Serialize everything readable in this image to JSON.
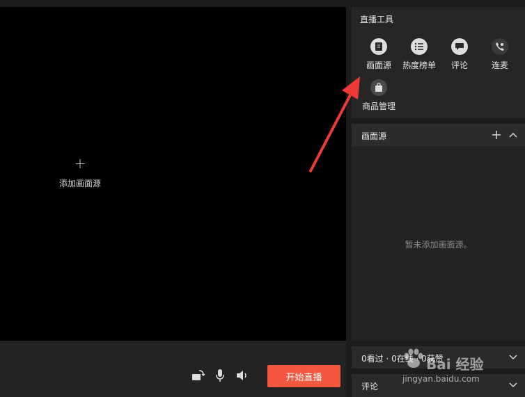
{
  "preview": {
    "add_source_label": "添加画面源"
  },
  "tools": {
    "title": "直播工具",
    "items": [
      {
        "label": "画面源",
        "icon": "document-icon"
      },
      {
        "label": "热度榜单",
        "icon": "list-icon"
      },
      {
        "label": "评论",
        "icon": "chat-bubble-icon"
      },
      {
        "label": "连麦",
        "icon": "phone-call-icon"
      },
      {
        "label": "商品管理",
        "icon": "shopping-bag-icon"
      }
    ]
  },
  "source_panel": {
    "title": "画面源",
    "empty_message": "暂未添加画面源。"
  },
  "stats": {
    "text": "0看过 · 0在线 · 0获赞"
  },
  "comment": {
    "title": "评论"
  },
  "controls": {
    "start_label": "开始直播"
  },
  "watermark": {
    "brand": "Bai 经验",
    "url": "jingyan.baidu.com"
  },
  "colors": {
    "accent": "#f4573f",
    "arrow": "#f03a3a"
  }
}
